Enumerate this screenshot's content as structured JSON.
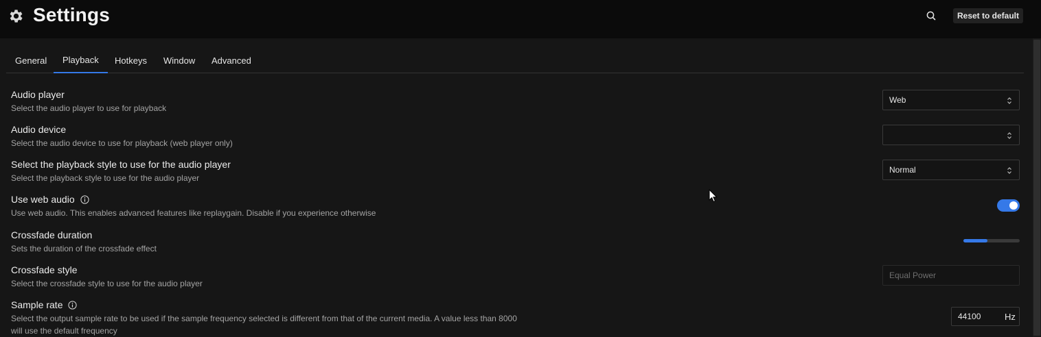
{
  "header": {
    "title": "Settings",
    "icon": "gear-icon",
    "search_icon": "search-icon",
    "reset_label": "Reset to default"
  },
  "tabs": [
    {
      "label": "General",
      "active": false
    },
    {
      "label": "Playback",
      "active": true
    },
    {
      "label": "Hotkeys",
      "active": false
    },
    {
      "label": "Window",
      "active": false
    },
    {
      "label": "Advanced",
      "active": false
    }
  ],
  "settings": {
    "audio_player": {
      "label": "Audio player",
      "description": "Select the audio player to use for playback",
      "value": "Web"
    },
    "audio_device": {
      "label": "Audio device",
      "description": "Select the audio device to use for playback (web player only)",
      "value": ""
    },
    "playback_style": {
      "label": "Select the playback style to use for the audio player",
      "description": "Select the playback style to use for the audio player",
      "value": "Normal"
    },
    "web_audio": {
      "label": "Use web audio",
      "description": "Use web audio. This enables advanced features like replaygain. Disable if you experience otherwise",
      "enabled": true
    },
    "crossfade_duration": {
      "label": "Crossfade duration",
      "description": "Sets the duration of the crossfade effect",
      "level": 0.43
    },
    "crossfade_style": {
      "label": "Crossfade style",
      "description": "Select the crossfade style to use for the audio player",
      "value": "Equal Power",
      "disabled": true
    },
    "sample_rate": {
      "label": "Sample rate",
      "description": "Select the output sample rate to be used if the sample frequency selected is different from that of the current media. A value less than 8000 will use the default frequency",
      "value": "44100",
      "unit": "Hz"
    }
  },
  "colors": {
    "accent": "#3579e8",
    "background": "#161616",
    "header_background": "#0b0b0b"
  }
}
